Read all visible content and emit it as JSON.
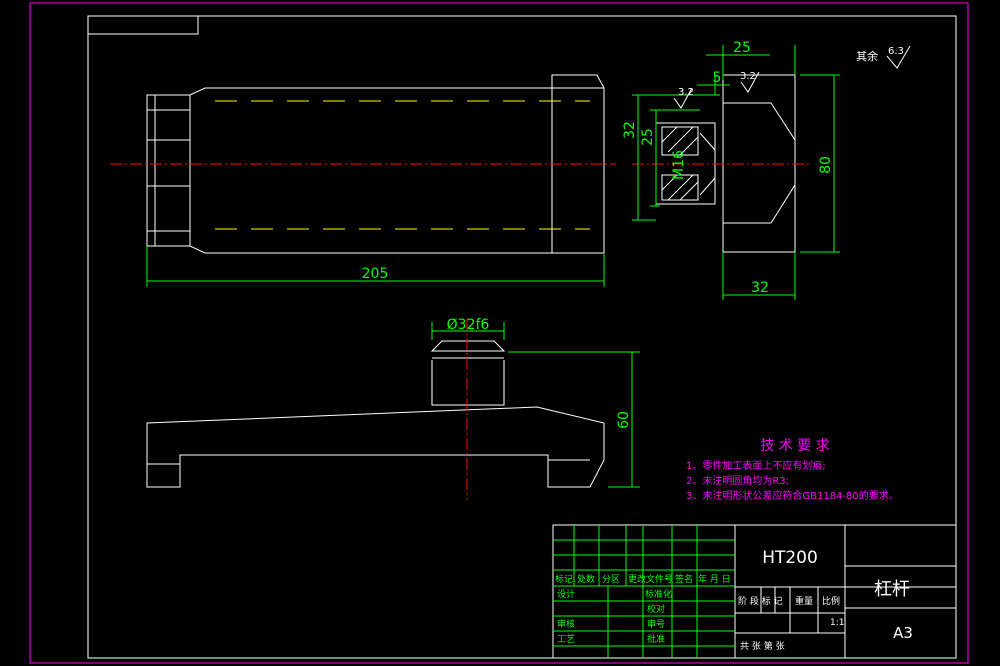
{
  "roughness": {
    "other_label": "其余",
    "other_value": "6.3",
    "side_a": "3.2",
    "side_b": "3.2"
  },
  "dimensions": {
    "top_width": "25",
    "small_width": "5",
    "overall_length": "205",
    "height_32_left": "32",
    "height_25_left": "25",
    "thread": "M16",
    "height_80": "80",
    "bottom_width": "32",
    "shaft_diameter": "Ø32f6",
    "height_60": "60"
  },
  "tech_requirements": {
    "title": "技 术 要 求",
    "items": [
      "1、零件加工表面上不应有划痕;",
      "2、未注明圆角均为R3;",
      "3、未注明形状公差应符合GB1184-80的要求。"
    ]
  },
  "title_block": {
    "material": "HT200",
    "part_name": "杠杆",
    "sheet_size": "A3",
    "scale": "1:1",
    "rev_headers": [
      "标记",
      "处数",
      "分区",
      "更改文件号",
      "签名",
      "年 月 日"
    ],
    "design": "设计",
    "standardize": "标准化",
    "review": "审核",
    "process": "工艺",
    "approve": "批准",
    "check": "校对",
    "seal_label": "审号",
    "stage_headers": [
      "阶 段 标 记",
      "重量",
      "比例"
    ],
    "sheet_text": "共   张  第   张"
  },
  "colors": {
    "outline": "#ffffff",
    "dimension": "#00ff00",
    "centerline": "#ff0000",
    "hidden": "#ffff00",
    "text_magenta": "#ff00ff"
  }
}
